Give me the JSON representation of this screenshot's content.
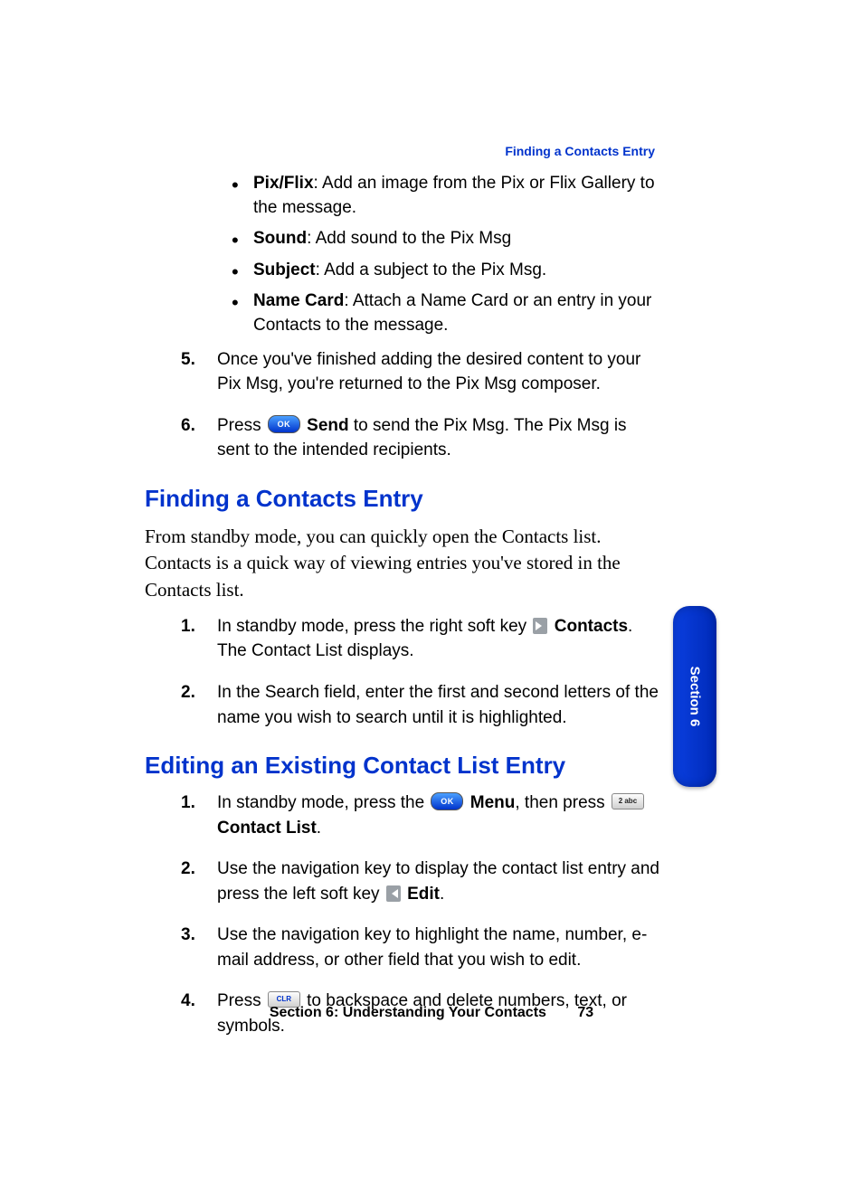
{
  "header_link": "Finding a Contacts Entry",
  "top_bullets": [
    {
      "term": "Pix/Flix",
      "desc": ": Add an image from the Pix or Flix Gallery to the message."
    },
    {
      "term": "Sound",
      "desc": ": Add sound to the Pix Msg"
    },
    {
      "term": "Subject",
      "desc": ": Add a subject to the Pix Msg."
    },
    {
      "term": "Name Card",
      "desc": ": Attach a Name Card or an entry in your Contacts to the message."
    }
  ],
  "top_steps_start": 4,
  "top_steps": [
    {
      "segments": [
        {
          "t": "Once you've finished adding the desired content to your Pix Msg, you're returned to the Pix Msg composer."
        }
      ]
    },
    {
      "segments": [
        {
          "t": "Press "
        },
        {
          "icon": "ok"
        },
        {
          "t": " "
        },
        {
          "b": "Send"
        },
        {
          "t": " to send the Pix Msg. The Pix Msg is sent to the intended recipients."
        }
      ]
    }
  ],
  "h_finding": "Finding a Contacts Entry",
  "finding_intro": "From standby mode, you can quickly open the Contacts list. Contacts is a quick way of viewing entries you've stored in the Contacts list.",
  "finding_steps": [
    {
      "segments": [
        {
          "t": "In standby mode, press the right soft key "
        },
        {
          "icon": "soft-right"
        },
        {
          "t": " "
        },
        {
          "b": "Contacts"
        },
        {
          "t": ". The Contact List displays."
        }
      ]
    },
    {
      "segments": [
        {
          "t": "In the Search field, enter the first and second letters of the name you wish to search until it is highlighted."
        }
      ]
    }
  ],
  "h_editing": "Editing an Existing Contact List Entry",
  "editing_steps": [
    {
      "segments": [
        {
          "t": "In standby mode, press the "
        },
        {
          "icon": "ok"
        },
        {
          "t": " "
        },
        {
          "b": "Menu"
        },
        {
          "t": ", then press "
        },
        {
          "icon": "2abc"
        },
        {
          "t": " "
        },
        {
          "b": "Contact List"
        },
        {
          "t": "."
        }
      ]
    },
    {
      "segments": [
        {
          "t": "Use the navigation key to display the contact list entry and press the left soft key "
        },
        {
          "icon": "soft-left"
        },
        {
          "t": " "
        },
        {
          "b": "Edit"
        },
        {
          "t": "."
        }
      ]
    },
    {
      "segments": [
        {
          "t": "Use the navigation key to highlight the name, number, e-mail address, or other field that you wish to edit."
        }
      ]
    },
    {
      "segments": [
        {
          "t": "Press "
        },
        {
          "icon": "clr"
        },
        {
          "t": " to backspace and delete numbers, text, or symbols."
        }
      ]
    }
  ],
  "side_tab": "Section 6",
  "footer_text": "Section 6: Understanding Your Contacts",
  "page_number": "73",
  "icons": {
    "ok": "OK",
    "clr": "CLR",
    "2abc": "2 abc"
  }
}
